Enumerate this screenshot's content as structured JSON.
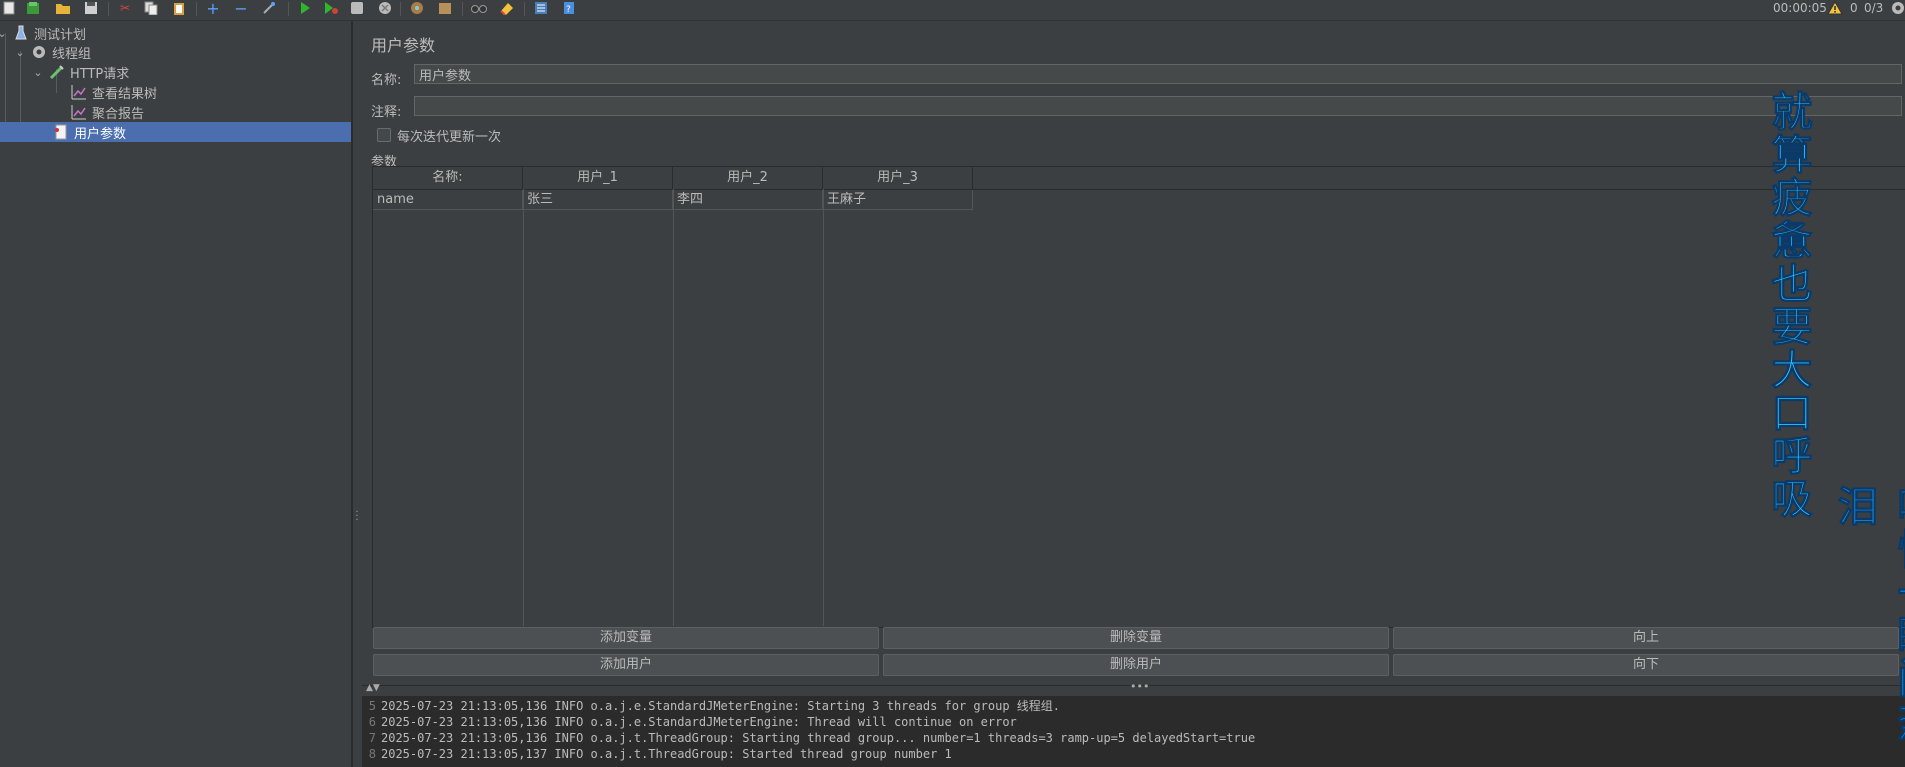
{
  "toolbar": {
    "elapsed": "00:00:05",
    "warning_count": "0",
    "threads": "0/3"
  },
  "tree": {
    "items": [
      {
        "label": "测试计划",
        "icon": "flask-icon"
      },
      {
        "label": "线程组",
        "icon": "gear-icon"
      },
      {
        "label": "HTTP请求",
        "icon": "pipette-icon"
      },
      {
        "label": "查看结果树",
        "icon": "graph-icon"
      },
      {
        "label": "聚合报告",
        "icon": "graph-icon"
      },
      {
        "label": "用户参数",
        "icon": "document-icon"
      }
    ],
    "selected_index": 5
  },
  "panel": {
    "title": "用户参数",
    "name_label": "名称:",
    "name_value": "用户参数",
    "comment_label": "注释:",
    "comment_value": "",
    "checkbox_label": "每次迭代更新一次",
    "params_label": "参数"
  },
  "table": {
    "headers": [
      "名称:",
      "用户_1",
      "用户_2",
      "用户_3"
    ],
    "rows": [
      [
        "name",
        "张三",
        "李四",
        "王麻子"
      ]
    ]
  },
  "buttons": {
    "add_variable": "添加变量",
    "delete_variable": "删除变量",
    "move_up": "向上",
    "add_user": "添加用户",
    "delete_user": "删除用户",
    "move_down": "向下"
  },
  "log": {
    "lines": [
      {
        "n": "5",
        "text": "2025-07-23 21:13:05,136 INFO o.a.j.e.StandardJMeterEngine: Starting 3 threads for group 线程组."
      },
      {
        "n": "6",
        "text": "2025-07-23 21:13:05,136 INFO o.a.j.e.StandardJMeterEngine: Thread will continue on error"
      },
      {
        "n": "7",
        "text": "2025-07-23 21:13:05,136 INFO o.a.j.t.ThreadGroup: Starting thread group... number=1 threads=3 ramp-up=5 delayedStart=true"
      },
      {
        "n": "8",
        "text": "2025-07-23 21:13:05,137 INFO o.a.j.t.ThreadGroup: Started thread group number 1"
      }
    ]
  },
  "overlay": {
    "line1": "就算疲惫也要大口呼吸",
    "line2": "哪怕一瞬间热泪"
  },
  "colors": {
    "background": "#3c3f41",
    "selection": "#4b6eaf",
    "overlay_cyan": "#2ec4ff",
    "overlay_blue": "#1a8fe0"
  }
}
